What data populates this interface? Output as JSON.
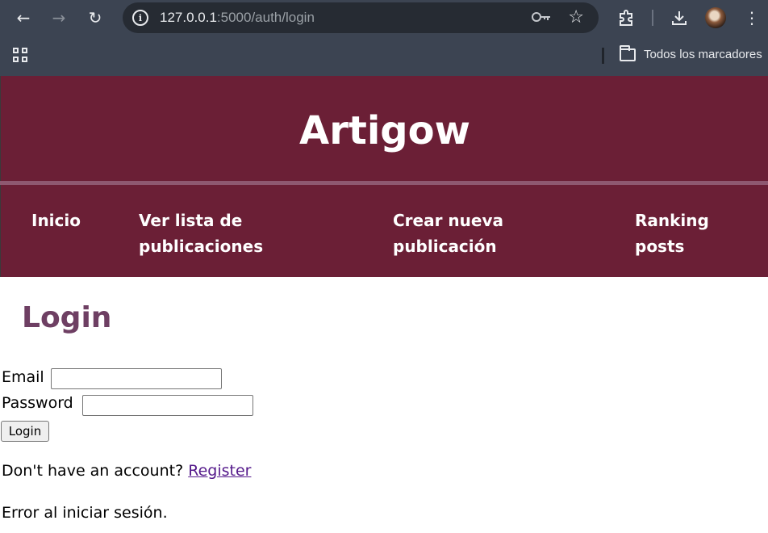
{
  "browser": {
    "url_host": "127.0.0.1",
    "url_path": ":5000/auth/login",
    "bookmarks_folder_label": "Todos los marcadores"
  },
  "site": {
    "title": "Artigow",
    "nav": [
      {
        "line1": "Inicio",
        "line2": ""
      },
      {
        "line1": "Ver lista de",
        "line2": "publicaciones"
      },
      {
        "line1": "Crear nueva",
        "line2": "publicación"
      },
      {
        "line1": "Ranking",
        "line2": "posts"
      }
    ]
  },
  "login": {
    "heading": "Login",
    "email_label": "Email",
    "email_value": "",
    "password_label": "Password",
    "password_value": "",
    "submit_label": "Login",
    "register_prompt": "Don't have an account?",
    "register_link": "Register",
    "error_message": "Error al iniciar sesión."
  },
  "colors": {
    "header_bg": "#6b1f36",
    "heading": "#6e3f63",
    "link_visited": "#551a8b"
  },
  "icons": [
    "back-icon",
    "forward-icon",
    "reload-icon",
    "site-info-icon",
    "password-key-icon",
    "bookmark-star-icon",
    "extensions-icon",
    "download-icon",
    "profile-avatar",
    "menu-kebab-icon",
    "apps-grid-icon",
    "folder-icon"
  ]
}
